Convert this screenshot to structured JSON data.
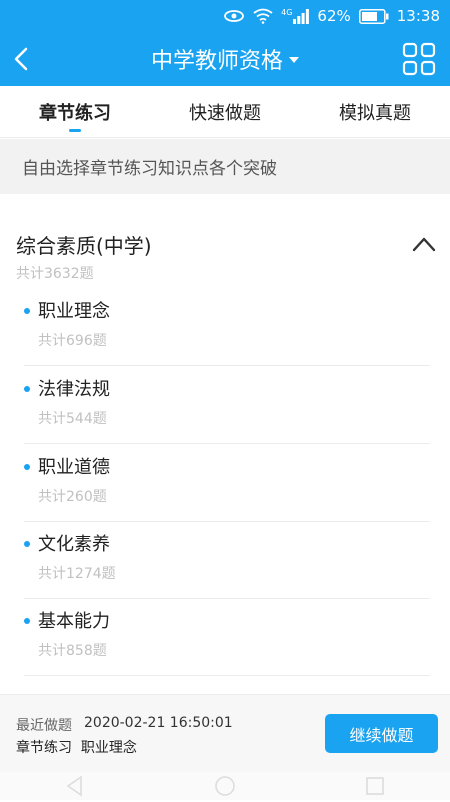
{
  "status_bar": {
    "network": "4G",
    "battery": "62%",
    "time": "13:38"
  },
  "app_bar": {
    "title": "中学教师资格",
    "icons": [
      "back-icon",
      "dropdown-caret-icon",
      "grid-menu-icon"
    ]
  },
  "tabs": [
    {
      "label": "章节练习",
      "active": true
    },
    {
      "label": "快速做题",
      "active": false
    },
    {
      "label": "模拟真题",
      "active": false
    }
  ],
  "banner": "自由选择章节练习知识点各个突破",
  "section": {
    "title": "综合素质(中学)",
    "count": "共计3632题",
    "items": [
      {
        "name": "职业理念",
        "count": "共计696题"
      },
      {
        "name": "法律法规",
        "count": "共计544题"
      },
      {
        "name": "职业道德",
        "count": "共计260题"
      },
      {
        "name": "文化素养",
        "count": "共计1274题"
      },
      {
        "name": "基本能力",
        "count": "共计858题"
      }
    ]
  },
  "footer": {
    "recent_label": "最近做题",
    "recent_time": "2020-02-21 16:50:01",
    "recent_where": "章节练习  职业理念",
    "continue_label": "继续做题"
  },
  "colors": {
    "accent": "#1aa3f0",
    "muted_text": "#c1c1c1"
  }
}
